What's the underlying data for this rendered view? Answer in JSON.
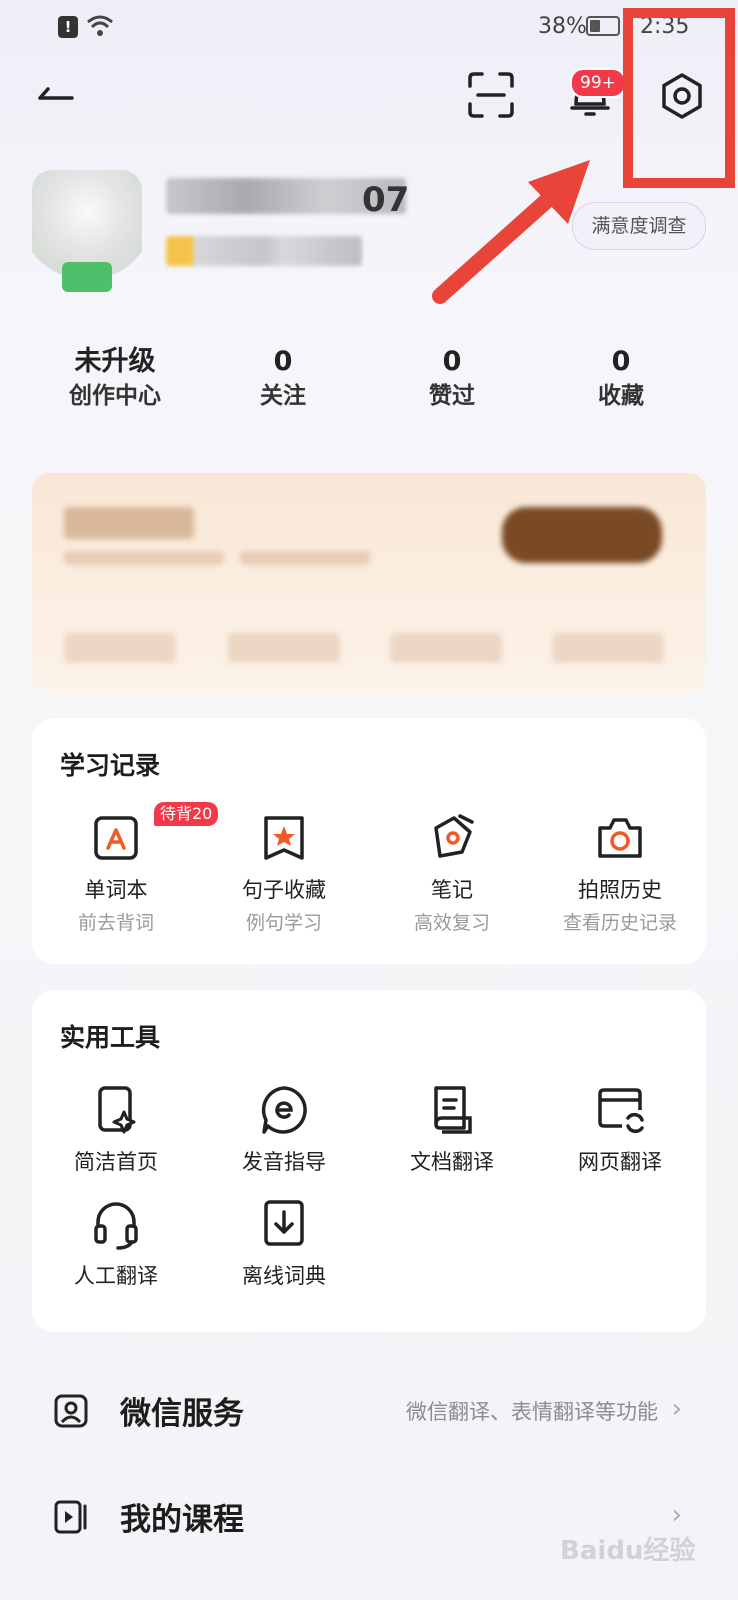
{
  "status_bar": {
    "battery": "38%",
    "time": "2:35"
  },
  "header": {
    "notification_badge": "99+"
  },
  "profile": {
    "name_tail": "07",
    "survey_button": "满意度调查"
  },
  "stats": [
    {
      "value": "未升级",
      "label": "创作中心"
    },
    {
      "value": "0",
      "label": "关注"
    },
    {
      "value": "0",
      "label": "赞过"
    },
    {
      "value": "0",
      "label": "收藏"
    }
  ],
  "study_records": {
    "title": "学习记录",
    "items": [
      {
        "title": "单词本",
        "subtitle": "前去背词",
        "badge": "待背20",
        "icon": "wordbook-icon"
      },
      {
        "title": "句子收藏",
        "subtitle": "例句学习",
        "icon": "sentence-favorite-icon"
      },
      {
        "title": "笔记",
        "subtitle": "高效复习",
        "icon": "note-icon"
      },
      {
        "title": "拍照历史",
        "subtitle": "查看历史记录",
        "icon": "camera-icon"
      }
    ]
  },
  "tools": {
    "title": "实用工具",
    "items": [
      {
        "title": "简洁首页",
        "icon": "simple-home-icon"
      },
      {
        "title": "发音指导",
        "icon": "pronunciation-icon"
      },
      {
        "title": "文档翻译",
        "icon": "document-translate-icon"
      },
      {
        "title": "网页翻译",
        "icon": "web-translate-icon"
      },
      {
        "title": "人工翻译",
        "icon": "headphones-icon"
      },
      {
        "title": "离线词典",
        "icon": "offline-dictionary-icon"
      }
    ]
  },
  "rows": [
    {
      "title": "微信服务",
      "desc": "微信翻译、表情翻译等功能",
      "icon": "wechat-service-icon"
    },
    {
      "title": "我的课程",
      "desc": "",
      "icon": "course-icon"
    }
  ],
  "watermark": "Baidu经验"
}
